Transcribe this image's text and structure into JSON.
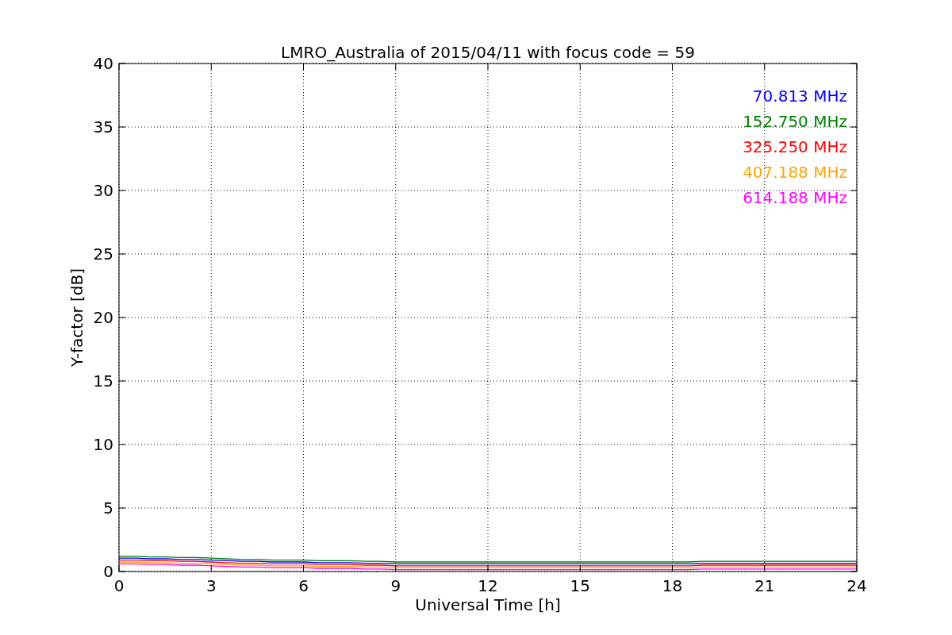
{
  "chart_data": {
    "type": "line",
    "title": "LMRO_Australia of 2015/04/11 with focus code = 59",
    "xlabel": "Universal Time [h]",
    "ylabel": "Y-factor [dB]",
    "x": [
      0,
      0.5,
      1,
      1.5,
      2,
      2.5,
      3,
      3.5,
      4,
      4.5,
      5,
      5.5,
      6,
      6.5,
      7,
      7.5,
      8,
      8.5,
      9,
      9.5,
      10,
      10.5,
      11,
      11.5,
      12,
      12.5,
      13,
      13.5,
      14,
      14.5,
      15,
      15.5,
      16,
      16.5,
      17,
      17.5,
      18,
      18.5,
      19,
      19.5,
      20,
      20.5,
      21,
      21.5,
      22,
      22.5,
      23,
      23.5,
      24
    ],
    "series": [
      {
        "name": "70.813 MHz",
        "color": "#0000ff",
        "values": [
          1.05,
          1.05,
          1.0,
          1.0,
          0.95,
          0.95,
          0.9,
          0.85,
          0.8,
          0.8,
          0.75,
          0.75,
          0.75,
          0.7,
          0.7,
          0.7,
          0.65,
          0.65,
          0.6,
          0.6,
          0.6,
          0.6,
          0.6,
          0.6,
          0.6,
          0.6,
          0.6,
          0.6,
          0.6,
          0.6,
          0.6,
          0.6,
          0.6,
          0.6,
          0.6,
          0.6,
          0.6,
          0.6,
          0.65,
          0.65,
          0.65,
          0.65,
          0.65,
          0.65,
          0.65,
          0.65,
          0.65,
          0.65,
          0.65
        ]
      },
      {
        "name": "152.750 MHz",
        "color": "#008000",
        "values": [
          1.2,
          1.2,
          1.15,
          1.15,
          1.1,
          1.1,
          1.05,
          1.0,
          0.95,
          0.95,
          0.9,
          0.9,
          0.9,
          0.85,
          0.85,
          0.85,
          0.8,
          0.8,
          0.75,
          0.75,
          0.75,
          0.75,
          0.75,
          0.75,
          0.75,
          0.75,
          0.75,
          0.75,
          0.75,
          0.75,
          0.75,
          0.75,
          0.75,
          0.75,
          0.75,
          0.75,
          0.75,
          0.75,
          0.8,
          0.8,
          0.8,
          0.8,
          0.8,
          0.8,
          0.8,
          0.8,
          0.8,
          0.8,
          0.8
        ]
      },
      {
        "name": "325.250 MHz",
        "color": "#ff0000",
        "values": [
          0.9,
          0.9,
          0.85,
          0.85,
          0.8,
          0.8,
          0.75,
          0.7,
          0.65,
          0.65,
          0.6,
          0.6,
          0.6,
          0.55,
          0.55,
          0.55,
          0.5,
          0.5,
          0.45,
          0.45,
          0.45,
          0.45,
          0.45,
          0.45,
          0.45,
          0.45,
          0.45,
          0.45,
          0.45,
          0.45,
          0.45,
          0.45,
          0.45,
          0.45,
          0.45,
          0.45,
          0.45,
          0.45,
          0.5,
          0.5,
          0.5,
          0.5,
          0.5,
          0.5,
          0.5,
          0.5,
          0.5,
          0.5,
          0.5
        ]
      },
      {
        "name": "407.188 MHz",
        "color": "#ffa500",
        "values": [
          0.75,
          0.75,
          0.7,
          0.7,
          0.65,
          0.65,
          0.6,
          0.55,
          0.5,
          0.5,
          0.45,
          0.45,
          0.45,
          0.4,
          0.4,
          0.4,
          0.35,
          0.35,
          0.3,
          0.3,
          0.3,
          0.3,
          0.3,
          0.3,
          0.3,
          0.3,
          0.3,
          0.3,
          0.3,
          0.3,
          0.3,
          0.3,
          0.3,
          0.3,
          0.3,
          0.3,
          0.3,
          0.3,
          0.35,
          0.35,
          0.35,
          0.35,
          0.35,
          0.35,
          0.35,
          0.35,
          0.35,
          0.35,
          0.35
        ]
      },
      {
        "name": "614.188 MHz",
        "color": "#ff00ff",
        "values": [
          0.6,
          0.6,
          0.55,
          0.55,
          0.5,
          0.5,
          0.45,
          0.4,
          0.35,
          0.35,
          0.3,
          0.3,
          0.3,
          0.25,
          0.25,
          0.25,
          0.2,
          0.2,
          0.15,
          0.15,
          0.15,
          0.15,
          0.15,
          0.15,
          0.15,
          0.15,
          0.15,
          0.15,
          0.15,
          0.15,
          0.15,
          0.15,
          0.15,
          0.15,
          0.15,
          0.15,
          0.15,
          0.15,
          0.2,
          0.2,
          0.2,
          0.2,
          0.2,
          0.2,
          0.2,
          0.2,
          0.2,
          0.2,
          0.2
        ]
      }
    ],
    "xlim": [
      0,
      24
    ],
    "ylim": [
      0,
      40
    ],
    "xticks": [
      0,
      3,
      6,
      9,
      12,
      15,
      18,
      21,
      24
    ],
    "yticks": [
      0,
      5,
      10,
      15,
      20,
      25,
      30,
      35,
      40
    ],
    "grid": true
  }
}
